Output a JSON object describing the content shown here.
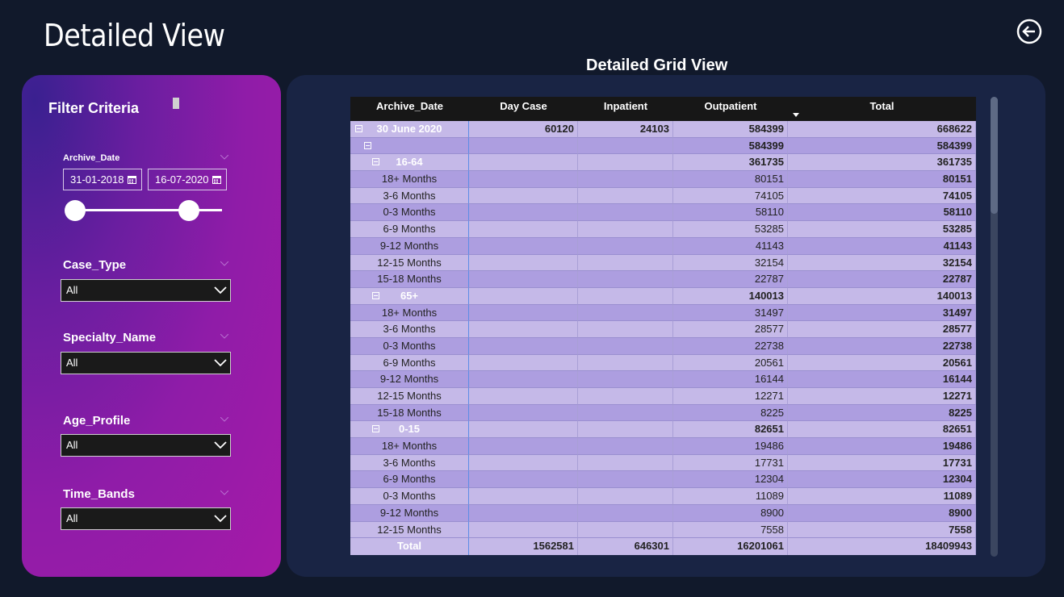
{
  "page": {
    "title": "Detailed View"
  },
  "grid": {
    "title": "Detailed Grid View"
  },
  "filters": {
    "title": "Filter Criteria",
    "archive_date": {
      "label": "Archive_Date",
      "start": "31-01-2018",
      "end": "16-07-2020"
    },
    "case_type": {
      "label": "Case_Type",
      "value": "All"
    },
    "specialty_name": {
      "label": "Specialty_Name",
      "value": "All"
    },
    "age_profile": {
      "label": "Age_Profile",
      "value": "All"
    },
    "time_bands": {
      "label": "Time_Bands",
      "value": "All"
    }
  },
  "matrix": {
    "columns": [
      "Archive_Date",
      "Day Case",
      "Inpatient",
      "Outpatient",
      "Total"
    ],
    "rows": [
      {
        "label": "30 June 2020",
        "level": 0,
        "day_case": "60120",
        "inpatient": "24103",
        "outpatient": "584399",
        "total": "668622"
      },
      {
        "label": "",
        "level": 1,
        "day_case": "",
        "inpatient": "",
        "outpatient": "584399",
        "total": "584399"
      },
      {
        "label": "16-64",
        "level": 2,
        "day_case": "",
        "inpatient": "",
        "outpatient": "361735",
        "total": "361735"
      },
      {
        "label": "18+ Months",
        "level": 3,
        "day_case": "",
        "inpatient": "",
        "outpatient": "80151",
        "total": "80151"
      },
      {
        "label": "3-6 Months",
        "level": 3,
        "day_case": "",
        "inpatient": "",
        "outpatient": "74105",
        "total": "74105"
      },
      {
        "label": "0-3 Months",
        "level": 3,
        "day_case": "",
        "inpatient": "",
        "outpatient": "58110",
        "total": "58110"
      },
      {
        "label": "6-9 Months",
        "level": 3,
        "day_case": "",
        "inpatient": "",
        "outpatient": "53285",
        "total": "53285"
      },
      {
        "label": "9-12 Months",
        "level": 3,
        "day_case": "",
        "inpatient": "",
        "outpatient": "41143",
        "total": "41143"
      },
      {
        "label": "12-15 Months",
        "level": 3,
        "day_case": "",
        "inpatient": "",
        "outpatient": "32154",
        "total": "32154"
      },
      {
        "label": "15-18 Months",
        "level": 3,
        "day_case": "",
        "inpatient": "",
        "outpatient": "22787",
        "total": "22787"
      },
      {
        "label": "65+",
        "level": 2,
        "day_case": "",
        "inpatient": "",
        "outpatient": "140013",
        "total": "140013"
      },
      {
        "label": "18+ Months",
        "level": 3,
        "day_case": "",
        "inpatient": "",
        "outpatient": "31497",
        "total": "31497"
      },
      {
        "label": "3-6 Months",
        "level": 3,
        "day_case": "",
        "inpatient": "",
        "outpatient": "28577",
        "total": "28577"
      },
      {
        "label": "0-3 Months",
        "level": 3,
        "day_case": "",
        "inpatient": "",
        "outpatient": "22738",
        "total": "22738"
      },
      {
        "label": "6-9 Months",
        "level": 3,
        "day_case": "",
        "inpatient": "",
        "outpatient": "20561",
        "total": "20561"
      },
      {
        "label": "9-12 Months",
        "level": 3,
        "day_case": "",
        "inpatient": "",
        "outpatient": "16144",
        "total": "16144"
      },
      {
        "label": "12-15 Months",
        "level": 3,
        "day_case": "",
        "inpatient": "",
        "outpatient": "12271",
        "total": "12271"
      },
      {
        "label": "15-18 Months",
        "level": 3,
        "day_case": "",
        "inpatient": "",
        "outpatient": "8225",
        "total": "8225"
      },
      {
        "label": "0-15",
        "level": 2,
        "day_case": "",
        "inpatient": "",
        "outpatient": "82651",
        "total": "82651"
      },
      {
        "label": "18+ Months",
        "level": 3,
        "day_case": "",
        "inpatient": "",
        "outpatient": "19486",
        "total": "19486"
      },
      {
        "label": "3-6 Months",
        "level": 3,
        "day_case": "",
        "inpatient": "",
        "outpatient": "17731",
        "total": "17731"
      },
      {
        "label": "6-9 Months",
        "level": 3,
        "day_case": "",
        "inpatient": "",
        "outpatient": "12304",
        "total": "12304"
      },
      {
        "label": "0-3 Months",
        "level": 3,
        "day_case": "",
        "inpatient": "",
        "outpatient": "11089",
        "total": "11089"
      },
      {
        "label": "9-12 Months",
        "level": 3,
        "day_case": "",
        "inpatient": "",
        "outpatient": "8900",
        "total": "8900"
      },
      {
        "label": "12-15 Months",
        "level": 3,
        "day_case": "",
        "inpatient": "",
        "outpatient": "7558",
        "total": "7558"
      }
    ],
    "total": {
      "label": "Total",
      "day_case": "1562581",
      "inpatient": "646301",
      "outpatient": "16201061",
      "total": "18409943"
    }
  },
  "colors": {
    "background": "#11192b",
    "panel": "#192444",
    "row_light": "#c5b9e8",
    "row_dark": "#ad9ee0",
    "filter_accent": "#a61aa8"
  },
  "icons": {
    "back": "back-arrow-icon",
    "calendar": "calendar-icon",
    "dropdown": "chevron-down-icon",
    "expander": "collapse-icon"
  }
}
